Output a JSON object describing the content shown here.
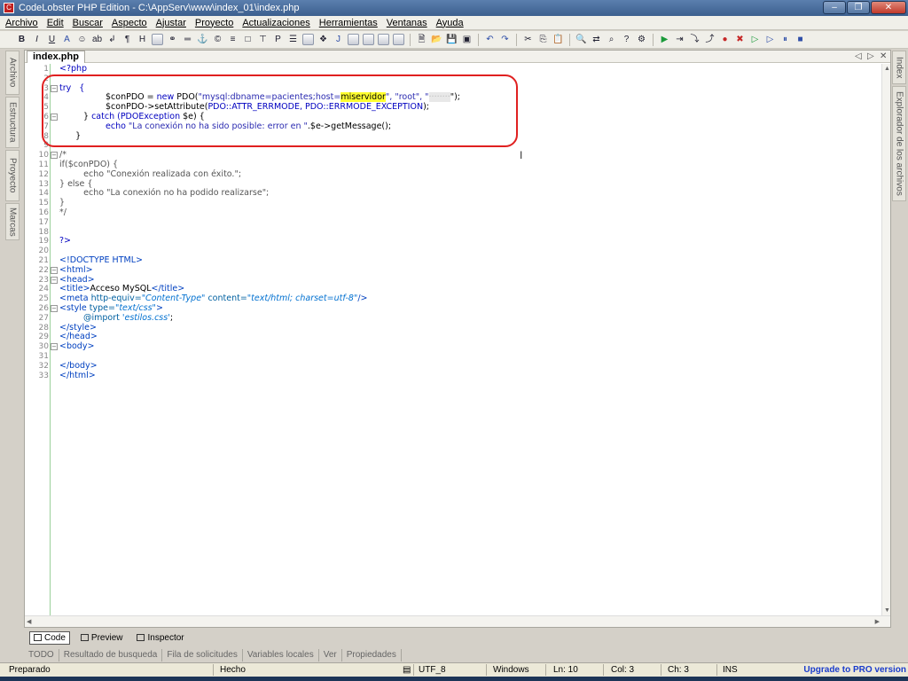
{
  "window": {
    "title": "CodeLobster PHP Edition - C:\\AppServ\\www\\index_01\\index.php",
    "minimize": "–",
    "maximize": "❐",
    "close": "✕"
  },
  "menu": [
    "Archivo",
    "Edit",
    "Buscar",
    "Aspecto",
    "Ajustar",
    "Proyecto",
    "Actualizaciones",
    "Herramientas",
    "Ventanas",
    "Ayuda"
  ],
  "left_tabs": [
    "Archivo",
    "Estructura",
    "Proyecto",
    "Marcas"
  ],
  "right_tabs": [
    "Index",
    "Explorador de los archivos"
  ],
  "editor": {
    "file_tab": "index.php",
    "nav_prev": "◁",
    "nav_next": "▷",
    "nav_close": "✕"
  },
  "code_lines": [
    {
      "n": "1",
      "text": "<?php"
    },
    {
      "n": "2",
      "text": ""
    },
    {
      "n": "3",
      "text": "try   {"
    },
    {
      "n": "4",
      "text": "              $conPDO = new PDO(\"mysql:dbname=pacientes;host=miservidor\", \"root\", \"\");"
    },
    {
      "n": "5",
      "text": "              $conPDO->setAttribute(PDO::ATTR_ERRMODE, PDO::ERRMODE_EXCEPTION);"
    },
    {
      "n": "6",
      "text": "      } catch (PDOException $e) {"
    },
    {
      "n": "7",
      "text": "              echo \"La conexión no ha sido posible: error en \".$e->getMessage();"
    },
    {
      "n": "8",
      "text": "      }"
    },
    {
      "n": "9",
      "text": ""
    },
    {
      "n": "10",
      "text": "/*"
    },
    {
      "n": "11",
      "text": "if($conPDO) {"
    },
    {
      "n": "12",
      "text": "         echo \"Conexión realizada con éxito.\";"
    },
    {
      "n": "13",
      "text": "} else {"
    },
    {
      "n": "14",
      "text": "         echo \"La conexión no ha podido realizarse\";"
    },
    {
      "n": "15",
      "text": "}"
    },
    {
      "n": "16",
      "text": "*/"
    },
    {
      "n": "17",
      "text": ""
    },
    {
      "n": "18",
      "text": ""
    },
    {
      "n": "19",
      "text": "?>"
    },
    {
      "n": "20",
      "text": ""
    },
    {
      "n": "21",
      "text": "<!DOCTYPE HTML>"
    },
    {
      "n": "22",
      "text": "<html>"
    },
    {
      "n": "23",
      "text": "<head>"
    },
    {
      "n": "24",
      "text": "<title>Acceso MySQL</title>"
    },
    {
      "n": "25",
      "text": "<meta http-equiv=\"Content-Type\" content=\"text/html; charset=utf-8\"/>"
    },
    {
      "n": "26",
      "text": "<style type=\"text/css\">"
    },
    {
      "n": "27",
      "text": "      @import 'estilos.css';"
    },
    {
      "n": "28",
      "text": "</style>"
    },
    {
      "n": "29",
      "text": "</head>"
    },
    {
      "n": "30",
      "text": "<body>"
    },
    {
      "n": "31",
      "text": ""
    },
    {
      "n": "32",
      "text": "</body>"
    },
    {
      "n": "33",
      "text": "</html>"
    }
  ],
  "code_snippets": {
    "l4_a": "$conPDO = ",
    "l4_new": "new",
    "l4_b": " PDO(",
    "l4_str1": "\"mysql:dbname=pacientes;host=",
    "l4_hl": "miservidor",
    "l4_str2": "\", \"root\", \"",
    "l4_blur": "········",
    "l4_end": "\");",
    "l5_a": "$conPDO->setAttribute(",
    "l5_b": "PDO::ATTR_ERRMODE, PDO::ERRMODE_EXCEPTION",
    "l5_c": ");",
    "l6_a": "} ",
    "l6_kw": "catch",
    "l6_b": " (PDOException ",
    "l6_c": "$e) {",
    "l7_kw": "echo",
    "l7_str": " \"La conexión no ha sido posible: error en \"",
    "l7_b": ".$e->getMessage();",
    "l24_a": "<title>",
    "l24_b": "Acceso MySQL",
    "l24_c": "</title>",
    "l25_tag": "<meta",
    "l25_attr1": " http-equiv=",
    "l25_v1": "\"Content-Type\"",
    "l25_attr2": " content=",
    "l25_v2": "\"text/html; charset=utf-8\"",
    "l25_end": "/>",
    "l26_tag": "<style",
    "l26_attr": " type=",
    "l26_v": "\"text/css\"",
    "l26_end": ">",
    "l27_a": "@import ",
    "l27_b": "'estilos.css'",
    "l27_c": ";"
  },
  "view_tabs": [
    "Code",
    "Preview",
    "Inspector"
  ],
  "bottom_tabs": [
    "TODO",
    "Resultado de busqueda",
    "Fila de solicitudes",
    "Variables locales",
    "Ver",
    "Propiedades"
  ],
  "status": {
    "ready": "Preparado",
    "done": "Hecho",
    "encoding": "UTF_8",
    "os": "Windows",
    "ln": "Ln: 10",
    "col": "Col: 3",
    "ch": "Ch: 3",
    "mode": "INS",
    "upgrade": "Upgrade to PRO version"
  }
}
